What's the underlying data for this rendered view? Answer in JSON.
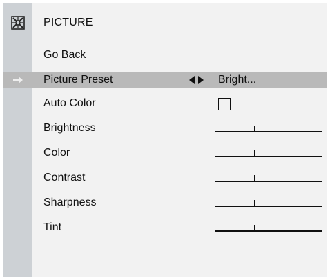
{
  "menu": {
    "title": "PICTURE",
    "go_back": "Go Back",
    "items": [
      {
        "label": "Picture Preset",
        "value": "Bright..."
      },
      {
        "label": "Auto Color",
        "checked": false
      },
      {
        "label": "Brightness",
        "level": 0.37
      },
      {
        "label": "Color",
        "level": 0.37
      },
      {
        "label": "Contrast",
        "level": 0.37
      },
      {
        "label": "Sharpness",
        "level": 0.37
      },
      {
        "label": "Tint",
        "level": 0.37
      }
    ]
  },
  "icons": {
    "logo": "tv-logo-icon",
    "selected": "right-arrow-icon",
    "value_switch": "left-right-arrows-icon"
  },
  "colors": {
    "background": "#f2f2f2",
    "sidebar": "#cdd1d5",
    "highlight": "#b9b9b9",
    "text": "#111111"
  }
}
